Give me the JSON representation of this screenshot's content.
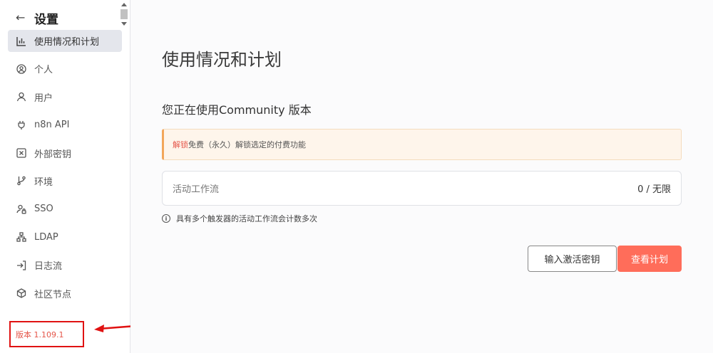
{
  "sidebar": {
    "title": "设置",
    "items": [
      {
        "label": "使用情况和计划",
        "icon": "bar-chart-icon",
        "active": true
      },
      {
        "label": "个人",
        "icon": "user-circle-icon"
      },
      {
        "label": "用户",
        "icon": "user-icon"
      },
      {
        "label": "n8n API",
        "icon": "plug-icon"
      },
      {
        "label": "外部密钥",
        "icon": "vault-icon"
      },
      {
        "label": "环境",
        "icon": "git-branch-icon"
      },
      {
        "label": "SSO",
        "icon": "user-lock-icon"
      },
      {
        "label": "LDAP",
        "icon": "network-icon"
      },
      {
        "label": "日志流",
        "icon": "sign-in-icon"
      },
      {
        "label": "社区节点",
        "icon": "cube-icon"
      }
    ],
    "version": "版本 1.109.1"
  },
  "main": {
    "title": "使用情况和计划",
    "plan_text": "您正在使用Community 版本",
    "alert": {
      "link": "解锁",
      "text": "免费（永久）解锁选定的付费功能"
    },
    "usage": {
      "label": "活动工作流",
      "value": "0 / 无限"
    },
    "note": "具有多个触发器的活动工作流会计数多次",
    "buttons": {
      "activation_key": "输入激活密钥",
      "view_plans": "查看计划"
    }
  },
  "colors": {
    "accent": "#ff6d5a",
    "annotation": "#e01212"
  }
}
